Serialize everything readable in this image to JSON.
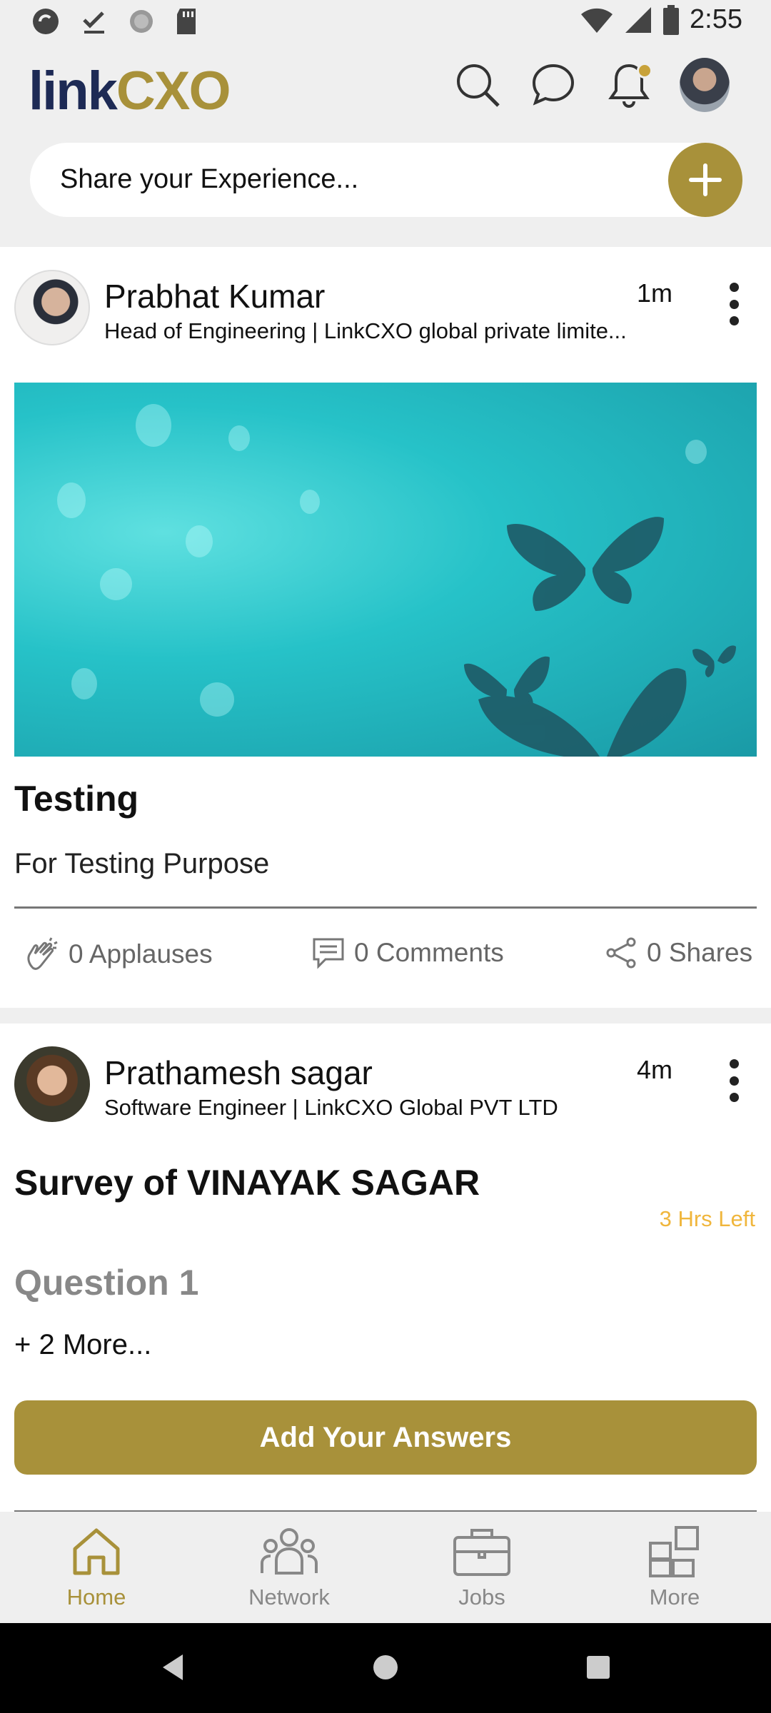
{
  "status_bar": {
    "time": "2:55"
  },
  "header": {
    "logo_part1": "link",
    "logo_part2": "CXO",
    "icons": [
      "search-icon",
      "chat-icon",
      "bell-icon",
      "profile-avatar"
    ]
  },
  "share": {
    "placeholder": "Share your Experience...",
    "add_icon": "plus-icon"
  },
  "posts": [
    {
      "author": "Prabhat Kumar",
      "subtitle": "Head of Engineering | LinkCXO global private limite...",
      "time": "1m",
      "title": "Testing",
      "body": "For Testing Purpose",
      "applauses": "0 Applauses",
      "comments": "0 Comments",
      "shares": "0 Shares"
    },
    {
      "author": "Prathamesh sagar",
      "subtitle": "Software  Engineer | LinkCXO Global PVT LTD",
      "time": "4m",
      "survey_title": "Survey of VINAYAK SAGAR",
      "time_left": "3 Hrs Left",
      "question": "Question 1",
      "more": "+ 2 More...",
      "button": "Add Your Answers"
    }
  ],
  "bottom_nav": [
    {
      "label": "Home",
      "icon": "home-icon",
      "active": true
    },
    {
      "label": "Network",
      "icon": "network-icon",
      "active": false
    },
    {
      "label": "Jobs",
      "icon": "briefcase-icon",
      "active": false
    },
    {
      "label": "More",
      "icon": "grid-icon",
      "active": false
    }
  ],
  "colors": {
    "accent": "#a8913a",
    "brand_dark": "#1d2a55",
    "warning": "#f0b63c"
  }
}
